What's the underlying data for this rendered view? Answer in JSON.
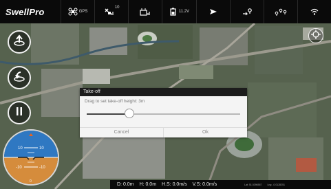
{
  "app": {
    "logo": "SwellPro"
  },
  "topbar": {
    "gps_label": "GPS",
    "satellites": "10",
    "battery": "11.2V"
  },
  "dialog": {
    "title": "Take-off",
    "message": "Drag to set take-off height: 3m",
    "slider_fraction": 0.28,
    "cancel_label": "Cancel",
    "ok_label": "Ok"
  },
  "horizon": {
    "labels": [
      "10",
      "10",
      "-10",
      "-10",
      "0"
    ],
    "sky_color": "#2f78c2",
    "ground_color": "#d58c3c"
  },
  "status": {
    "distance": "D: 0.0m",
    "height": "H: 0.0m",
    "hspeed": "H.S: 0.0m/s",
    "vspeed": "V.S: 0.0m/s",
    "lat": "Lat: 51.5396567",
    "lng": "Lng: -0.0128251"
  }
}
